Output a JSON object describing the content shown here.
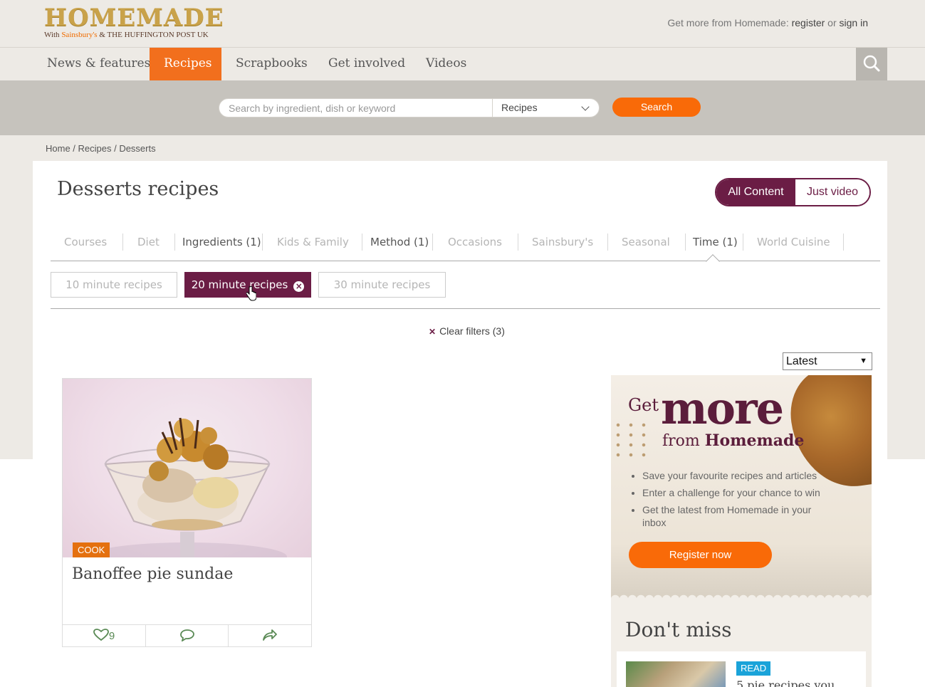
{
  "header": {
    "logo": "HOMEMADE",
    "logo_sub_prefix": "With ",
    "logo_sub_brand": "Sainsbury's",
    "logo_sub_suffix": " & THE HUFFINGTON POST UK",
    "account_prefix": "Get more from Homemade: ",
    "register": "register",
    "or": " or ",
    "sign_in": "sign in"
  },
  "nav": {
    "items": [
      "News & features",
      "Recipes",
      "Scrapbooks",
      "Get involved",
      "Videos"
    ],
    "active": "Recipes"
  },
  "search": {
    "placeholder": "Search by ingredient, dish or keyword",
    "scope": "Recipes",
    "button": "Search"
  },
  "breadcrumb": "Home / Recipes / Desserts",
  "page": {
    "title": "Desserts recipes",
    "toggle_all": "All Content",
    "toggle_video": "Just video"
  },
  "filter_tabs": [
    {
      "label": "Courses",
      "active": false
    },
    {
      "label": "Diet",
      "active": false
    },
    {
      "label": "Ingredients (1)",
      "active": true
    },
    {
      "label": "Kids & Family",
      "active": false
    },
    {
      "label": "Method (1)",
      "active": true
    },
    {
      "label": "Occasions",
      "active": false
    },
    {
      "label": "Sainsbury's",
      "active": false
    },
    {
      "label": "Seasonal",
      "active": false
    },
    {
      "label": "Time (1)",
      "active": true
    },
    {
      "label": "World Cuisine",
      "active": false
    }
  ],
  "time_chips": [
    {
      "label": "10 minute recipes",
      "selected": false
    },
    {
      "label": "20 minute recipes",
      "selected": true
    },
    {
      "label": "30 minute recipes",
      "selected": false
    }
  ],
  "clear_filters": "Clear filters (3)",
  "sort": {
    "selected": "Latest"
  },
  "recipe_card": {
    "badge": "COOK",
    "title": "Banoffee pie sundae",
    "likes": "9",
    "icons": [
      "heart-icon",
      "comment-icon",
      "share-icon"
    ]
  },
  "promo": {
    "get": "Get",
    "more": "more",
    "from": "from ",
    "brand": "Homemade",
    "bullets": [
      "Save your favourite recipes and articles",
      "Enter a challenge for your chance to win",
      "Get the latest from Homemade in your inbox"
    ],
    "button": "Register now"
  },
  "dont_miss": {
    "title": "Don't miss",
    "tag": "READ",
    "text": "5 pie recipes you"
  },
  "colors": {
    "accent_orange": "#f26f1d",
    "plum": "#6b1d45",
    "page_bg": "#edeae5"
  }
}
